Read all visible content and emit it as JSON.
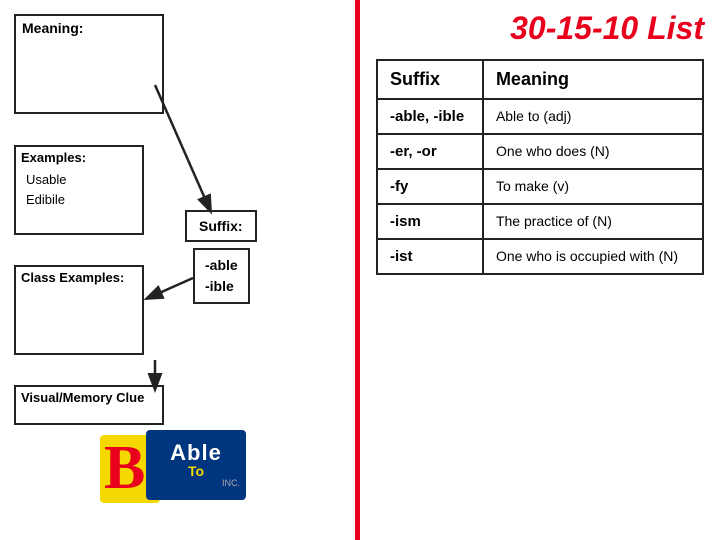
{
  "page": {
    "title": "30-15-10 List",
    "divider_color": "#e8001c"
  },
  "left": {
    "meaning_label": "Meaning:",
    "examples_label": "Examples:",
    "examples_items": [
      "Usable",
      "Edibile"
    ],
    "class_examples_label": "Class Examples:",
    "visual_label": "Visual/Memory Clue",
    "suffix_label": "Suffix:",
    "suffix_values": [
      "-able",
      "-ible"
    ]
  },
  "table": {
    "col1_header": "Suffix",
    "col2_header": "Meaning",
    "rows": [
      {
        "suffix": "-able, -ible",
        "meaning": "Able to (adj)"
      },
      {
        "suffix": "-er, -or",
        "meaning": "One who does (N)"
      },
      {
        "suffix": "-fy",
        "meaning": "To make (v)"
      },
      {
        "suffix": "-ism",
        "meaning": "The practice of (N)"
      },
      {
        "suffix": "-ist",
        "meaning": "One who is occupied with (N)"
      }
    ]
  },
  "logo": {
    "letter": "B",
    "able": "Able",
    "to": "To",
    "inc": "INC."
  }
}
